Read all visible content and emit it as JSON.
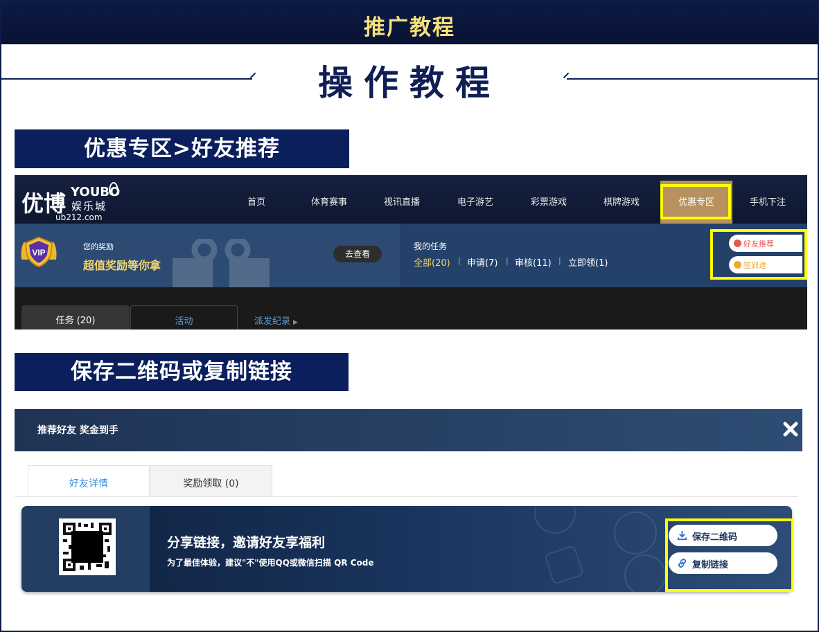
{
  "header": {
    "title": "推广教程"
  },
  "main_title": "操作教程",
  "sections": [
    {
      "title": "优惠专区>好友推荐"
    },
    {
      "title": "保存二维码或复制链接"
    }
  ],
  "site": {
    "logo": {
      "main": "优博",
      "brand": "YOUBO",
      "sub": "娱乐城",
      "url": "ub212.com"
    },
    "nav": [
      "首页",
      "体育赛事",
      "视讯直播",
      "电子游艺",
      "彩票游戏",
      "棋牌游戏",
      "优惠专区",
      "手机下注"
    ],
    "reward": {
      "label": "您的奖励",
      "promo": "超值奖励等你拿",
      "view_button": "去查看",
      "badge": "VIP"
    },
    "tasks": {
      "label": "我的任务",
      "filters": [
        "全部(20)",
        "申请(7)",
        "审核(11)",
        "立即领(1)"
      ]
    },
    "side_buttons": [
      "好友推荐",
      "签到送"
    ],
    "tabs": [
      "任务 (20)",
      "活动"
    ],
    "dispatch_link": "派发纪录"
  },
  "modal": {
    "title": "推荐好友 奖金到手",
    "tabs": [
      "好友详情",
      "奖励领取 (0)"
    ],
    "share": {
      "title": "分享链接，邀请好友享福利",
      "note": "为了最佳体验，建议\"不\"使用QQ或微信扫描 QR Code",
      "save_qr": "保存二维码",
      "copy_link": "复制链接"
    }
  },
  "colors": {
    "navy": "#0b1f5c",
    "gold": "#b8925e",
    "highlight": "#ffff00",
    "title_gold": "#f5e27a"
  }
}
